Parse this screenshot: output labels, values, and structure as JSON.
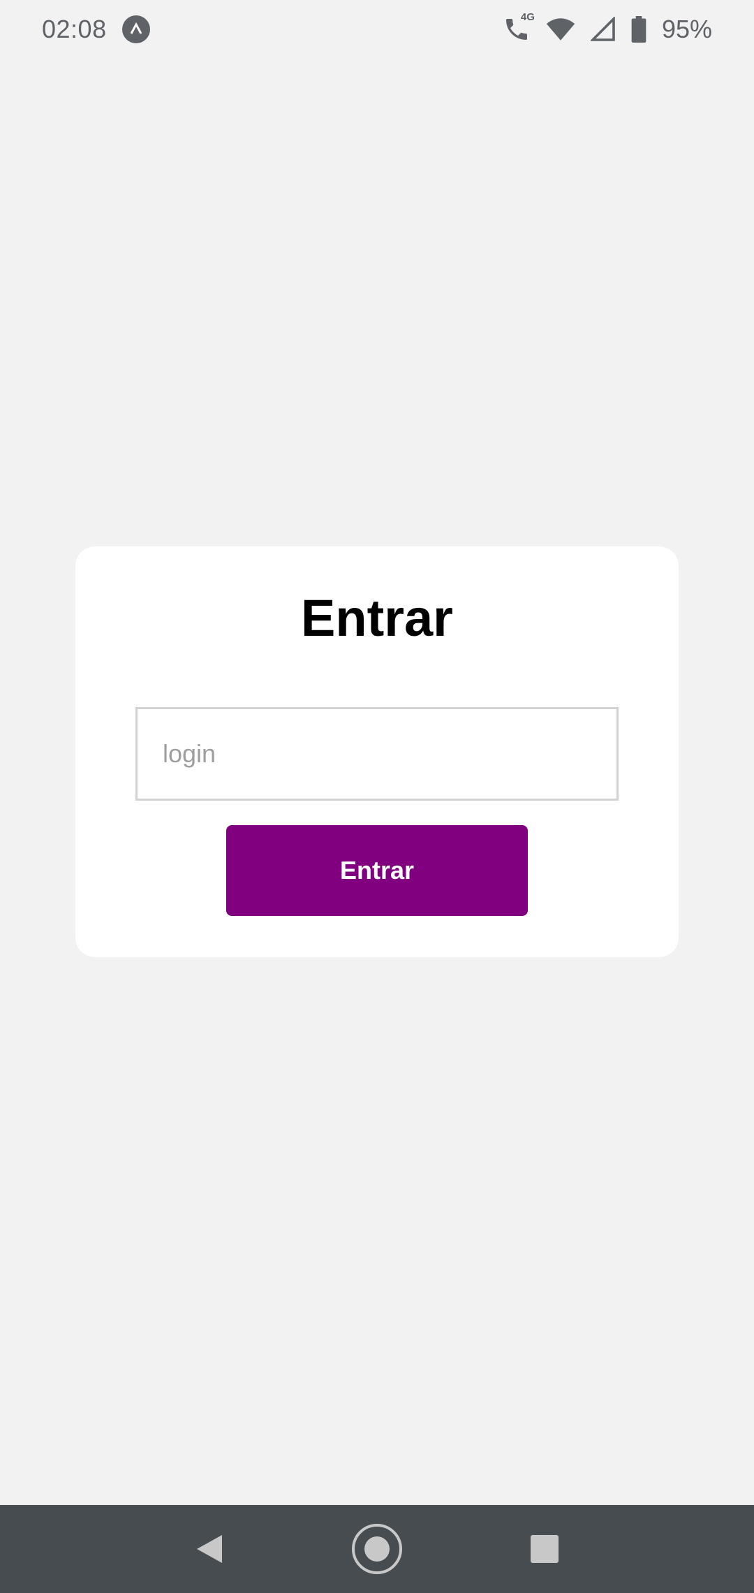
{
  "status_bar": {
    "time": "02:08",
    "app_icon": "caret-up-icon",
    "call_icon": "phone-4g-icon",
    "call_label": "4G",
    "wifi_icon": "wifi-icon",
    "signal_icon": "cell-signal-icon",
    "battery_icon": "battery-icon",
    "battery_percent": "95%"
  },
  "login_card": {
    "title": "Entrar",
    "login_input": {
      "value": "",
      "placeholder": "login"
    },
    "submit_label": "Entrar",
    "submit_color": "#800080"
  },
  "nav_bar": {
    "back_icon": "back-triangle-icon",
    "home_icon": "home-circle-icon",
    "recents_icon": "recents-square-icon"
  },
  "colors": {
    "background": "#f2f2f2",
    "card": "#ffffff",
    "nav_bar": "#474c50"
  }
}
